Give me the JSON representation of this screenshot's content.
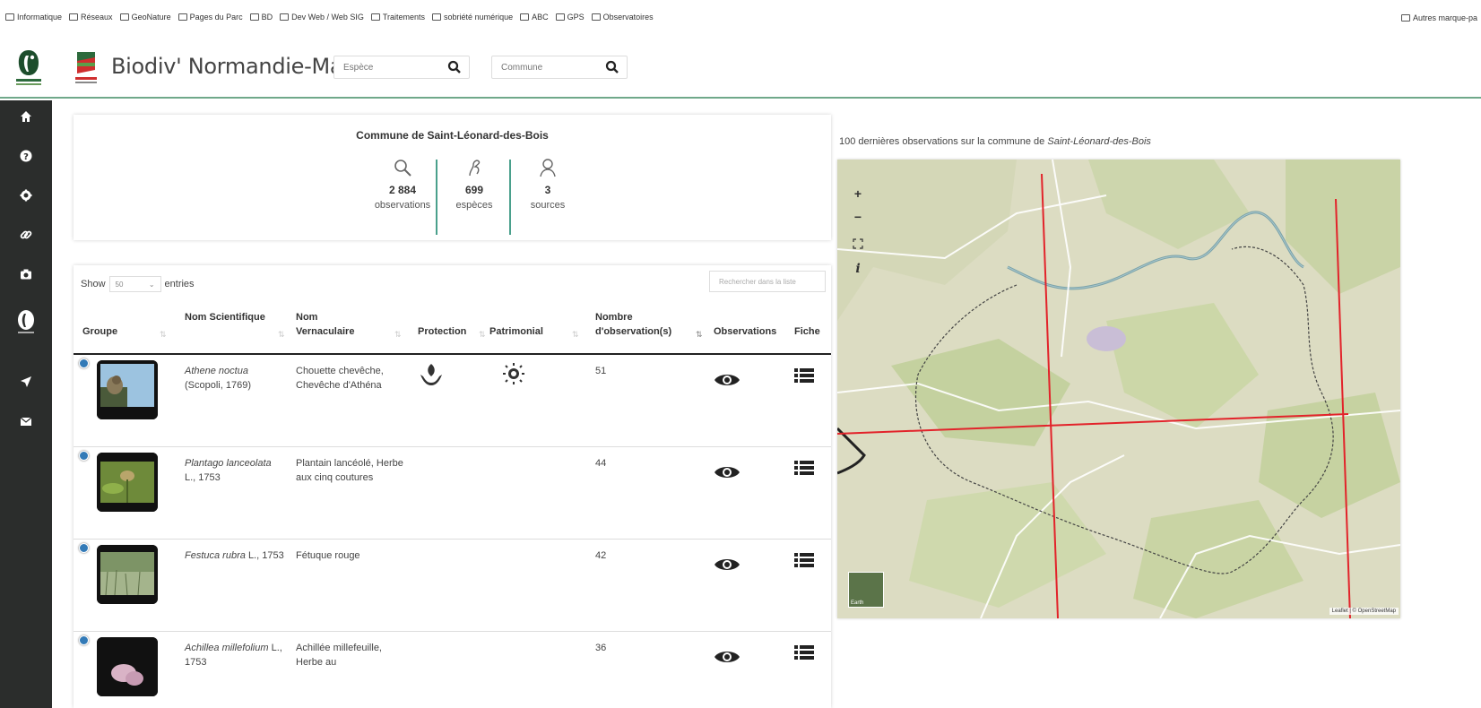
{
  "bookmarks": {
    "items": [
      "Informatique",
      "Réseaux",
      "GeoNature",
      "Pages du Parc",
      "BD",
      "Dev Web / Web SIG",
      "Traitements",
      "sobriété numérique",
      "ABC",
      "GPS",
      "Observatoires"
    ],
    "other": "Autres marque-pa"
  },
  "header": {
    "title": "Biodiv' Normandie-Maine",
    "search_species_placeholder": "Espèce",
    "search_commune_placeholder": "Commune"
  },
  "stats": {
    "commune_title": "Commune de Saint-Léonard-des-Bois",
    "observations_value": "2 884",
    "observations_label": "observations",
    "species_value": "699",
    "species_label": "espèces",
    "sources_value": "3",
    "sources_label": "sources"
  },
  "table": {
    "show_label": "Show",
    "entries_label": "entries",
    "page_length": "50",
    "filter_placeholder": "Rechercher dans la liste",
    "headers": {
      "groupe": "Groupe",
      "nom_sci": "Nom Scientifique",
      "nom_vern": "Nom Vernaculaire",
      "protection": "Protection",
      "patrimonial": "Patrimonial",
      "nb_obs": "Nombre d'observation(s)",
      "observations": "Observations",
      "fiche": "Fiche"
    },
    "rows": [
      {
        "sci_name": "Athene noctua",
        "sci_author": "(Scopoli, 1769)",
        "vern": "Chouette chevêche, Chevêche d'Athéna",
        "count": "51"
      },
      {
        "sci_name": "Plantago lanceolata",
        "sci_author": "L., 1753",
        "vern": "Plantain lancéolé, Herbe aux cinq coutures",
        "count": "44"
      },
      {
        "sci_name": "Festuca rubra",
        "sci_author": "L., 1753",
        "vern": "Fétuque rouge",
        "count": "42"
      },
      {
        "sci_name": "Achillea millefolium",
        "sci_author": "L., 1753",
        "vern": "Achillée millefeuille, Herbe au",
        "count": "36"
      }
    ]
  },
  "map": {
    "title_prefix": "100 dernières observations sur la commune de ",
    "title_commune": "Saint-Léonard-des-Bois",
    "zoom_in": "+",
    "zoom_out": "−",
    "info": "i",
    "attribution": "Leaflet | © OpenStreetMap",
    "layer_label": "Earth"
  },
  "colors": {
    "sidebar": "#2b2d2c",
    "accent": "#4aa08c",
    "grid_line": "#e2232a"
  }
}
